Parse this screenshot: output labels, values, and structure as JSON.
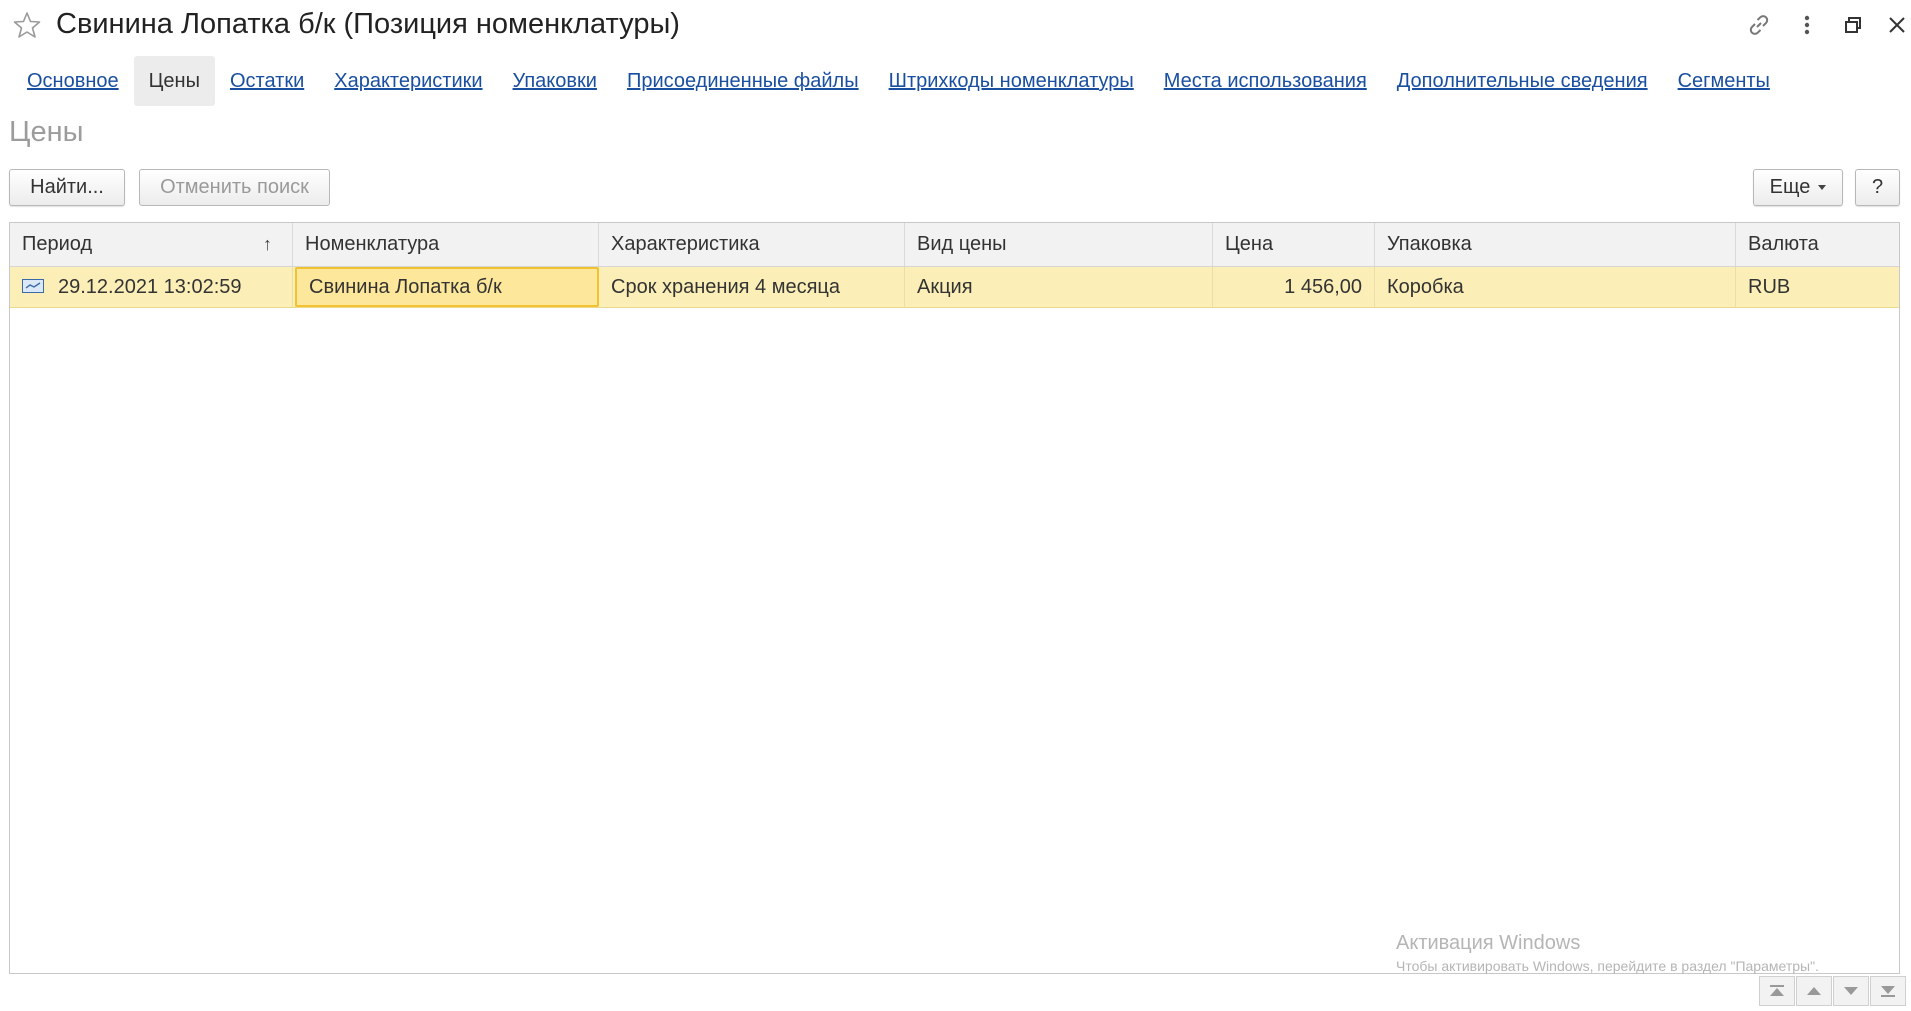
{
  "window": {
    "title": "Свинина Лопатка б/к (Позиция номенклатуры)",
    "icons": [
      "star-icon",
      "link-icon",
      "more-icon",
      "restore-icon",
      "close-icon"
    ]
  },
  "tabs": [
    {
      "label": "Основное",
      "active": false
    },
    {
      "label": "Цены",
      "active": true
    },
    {
      "label": "Остатки",
      "active": false
    },
    {
      "label": "Характеристики",
      "active": false
    },
    {
      "label": "Упаковки",
      "active": false
    },
    {
      "label": "Присоединенные файлы",
      "active": false
    },
    {
      "label": "Штрихкоды номенклатуры",
      "active": false
    },
    {
      "label": "Места использования",
      "active": false
    },
    {
      "label": "Дополнительные сведения",
      "active": false
    },
    {
      "label": "Сегменты",
      "active": false
    }
  ],
  "section_title": "Цены",
  "toolbar": {
    "find_label": "Найти...",
    "cancel_search_label": "Отменить поиск",
    "more_label": "Еще",
    "help_label": "?"
  },
  "table": {
    "columns": [
      "Период",
      "Номенклатура",
      "Характеристика",
      "Вид цены",
      "Цена",
      "Упаковка",
      "Валюта"
    ],
    "sort_indicator": "↑",
    "rows": [
      [
        "29.12.2021 13:02:59",
        "Свинина Лопатка б/к",
        "Срок хранения 4 месяца",
        "Акция",
        "1 456,00",
        "Коробка",
        "RUB"
      ]
    ]
  },
  "watermark": {
    "line1": "Активация Windows",
    "line2": "Чтобы активировать Windows, перейдите в раздел \"Параметры\"."
  },
  "colors": {
    "link": "#1a4fa0",
    "selected_row": "#fbefb7",
    "current_cell_border": "#f1c232"
  }
}
